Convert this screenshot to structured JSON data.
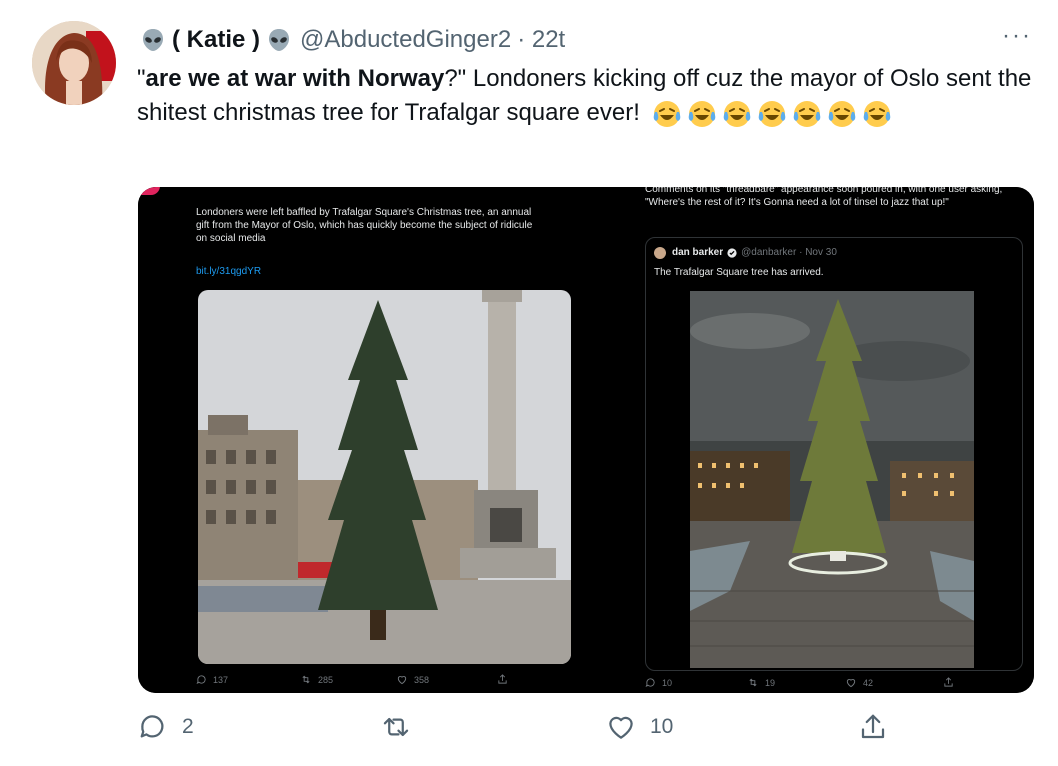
{
  "author": {
    "display_name": "( Katie )",
    "handle": "@AbductedGinger2",
    "time": "· 22t"
  },
  "tweet": {
    "quote_bold": "are we at war with Norway",
    "quote_open": "\"",
    "quote_close": "?\"",
    "rest": " Londoners kicking off cuz the mayor of Oslo sent the shitest christmas tree for Trafalgar square ever!"
  },
  "media_left": {
    "text": "Londoners were left baffled by Trafalgar Square's Christmas tree, an annual gift from the Mayor of Oslo, which has quickly become the subject of ridicule on social media",
    "link": "bit.ly/31qgdYR",
    "stats": {
      "replies": "137",
      "retweets": "285",
      "likes": "358"
    }
  },
  "media_right": {
    "top_text": "Comments on its \"threadbare\" appearance soon poured in, with one user asking, \"Where's the rest of it? It's Gonna need a lot of tinsel to jazz that up!\"",
    "quoted_name": "dan barker",
    "quoted_handle": "@danbarker · Nov 30",
    "quoted_text": "The Trafalgar Square tree has arrived.",
    "stats": {
      "replies": "10",
      "retweets": "19",
      "likes": "42"
    }
  },
  "actions": {
    "replies": "2",
    "likes": "10"
  },
  "colors": {
    "text": "#0f1419",
    "muted": "#536471",
    "link": "#1d9bf0"
  }
}
